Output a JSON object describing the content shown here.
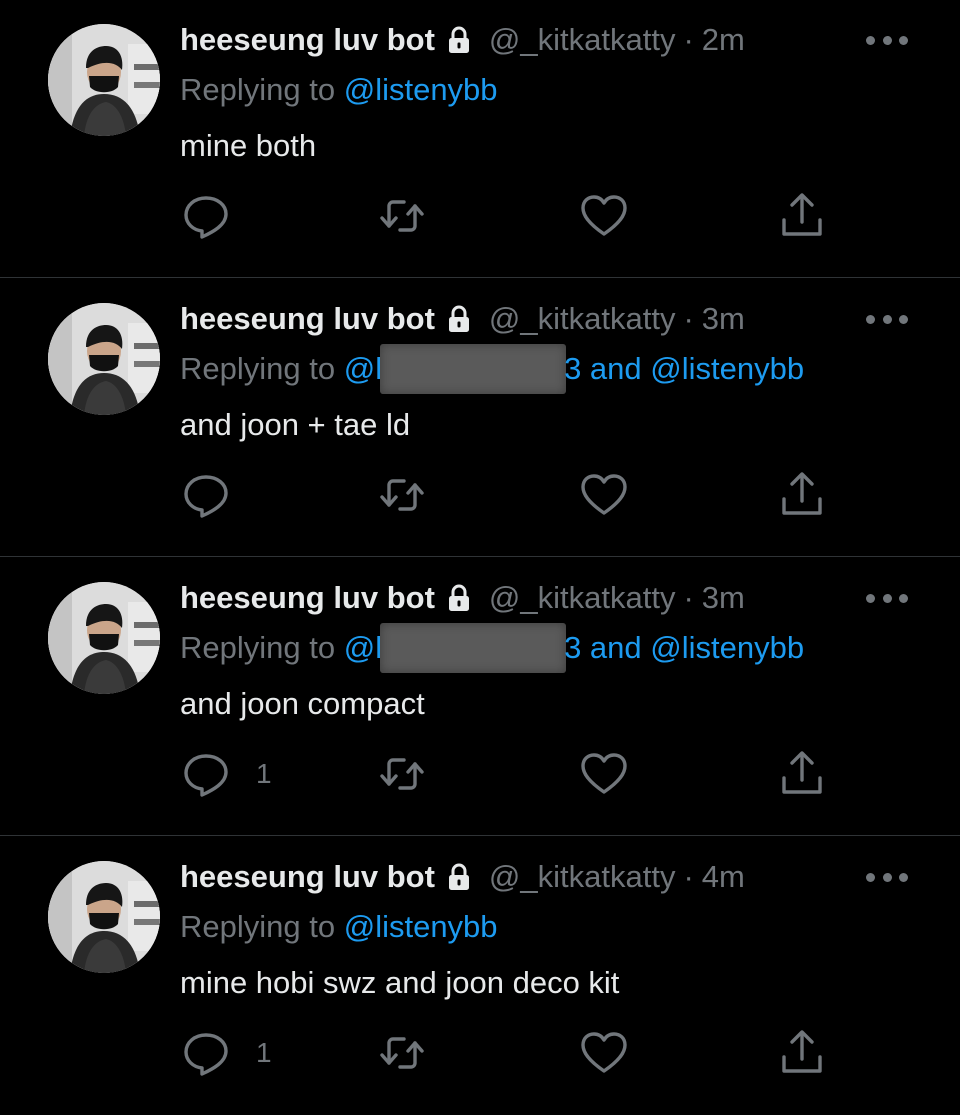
{
  "colors": {
    "background": "#000000",
    "text_primary": "#e7e9ea",
    "text_secondary": "#71767b",
    "link": "#1d9bf0",
    "divider": "#2f3336"
  },
  "tweets": [
    {
      "display_name": "heeseung luv bot",
      "handle": "@_kitkatkatty",
      "separator": "·",
      "time": "2m",
      "replying_prefix": "Replying to",
      "mention_a": "@listenybb",
      "mention_b": "",
      "redacted": false,
      "text": "mine both",
      "reply_count": ""
    },
    {
      "display_name": "heeseung luv bot",
      "handle": "@_kitkatkatty",
      "separator": "·",
      "time": "3m",
      "replying_prefix": "Replying to",
      "mention_a": "@l",
      "mention_b": "3 and @listenybb",
      "redacted": true,
      "text": "and joon + tae ld",
      "reply_count": ""
    },
    {
      "display_name": "heeseung luv bot",
      "handle": "@_kitkatkatty",
      "separator": "·",
      "time": "3m",
      "replying_prefix": "Replying to",
      "mention_a": "@l",
      "mention_b": "3 and @listenybb",
      "redacted": true,
      "text": "and joon compact",
      "reply_count": "1"
    },
    {
      "display_name": "heeseung luv bot",
      "handle": "@_kitkatkatty",
      "separator": "·",
      "time": "4m",
      "replying_prefix": "Replying to",
      "mention_a": "@listenybb",
      "mention_b": "",
      "redacted": false,
      "text": "mine hobi swz and joon deco kit",
      "reply_count": "1"
    }
  ],
  "icons": {
    "avatar": "avatar-photo",
    "lock": "lock-icon",
    "more": "more-horizontal-icon",
    "reply": "reply-bubble-icon",
    "retweet": "retweet-icon",
    "like": "heart-icon",
    "share": "share-icon"
  }
}
